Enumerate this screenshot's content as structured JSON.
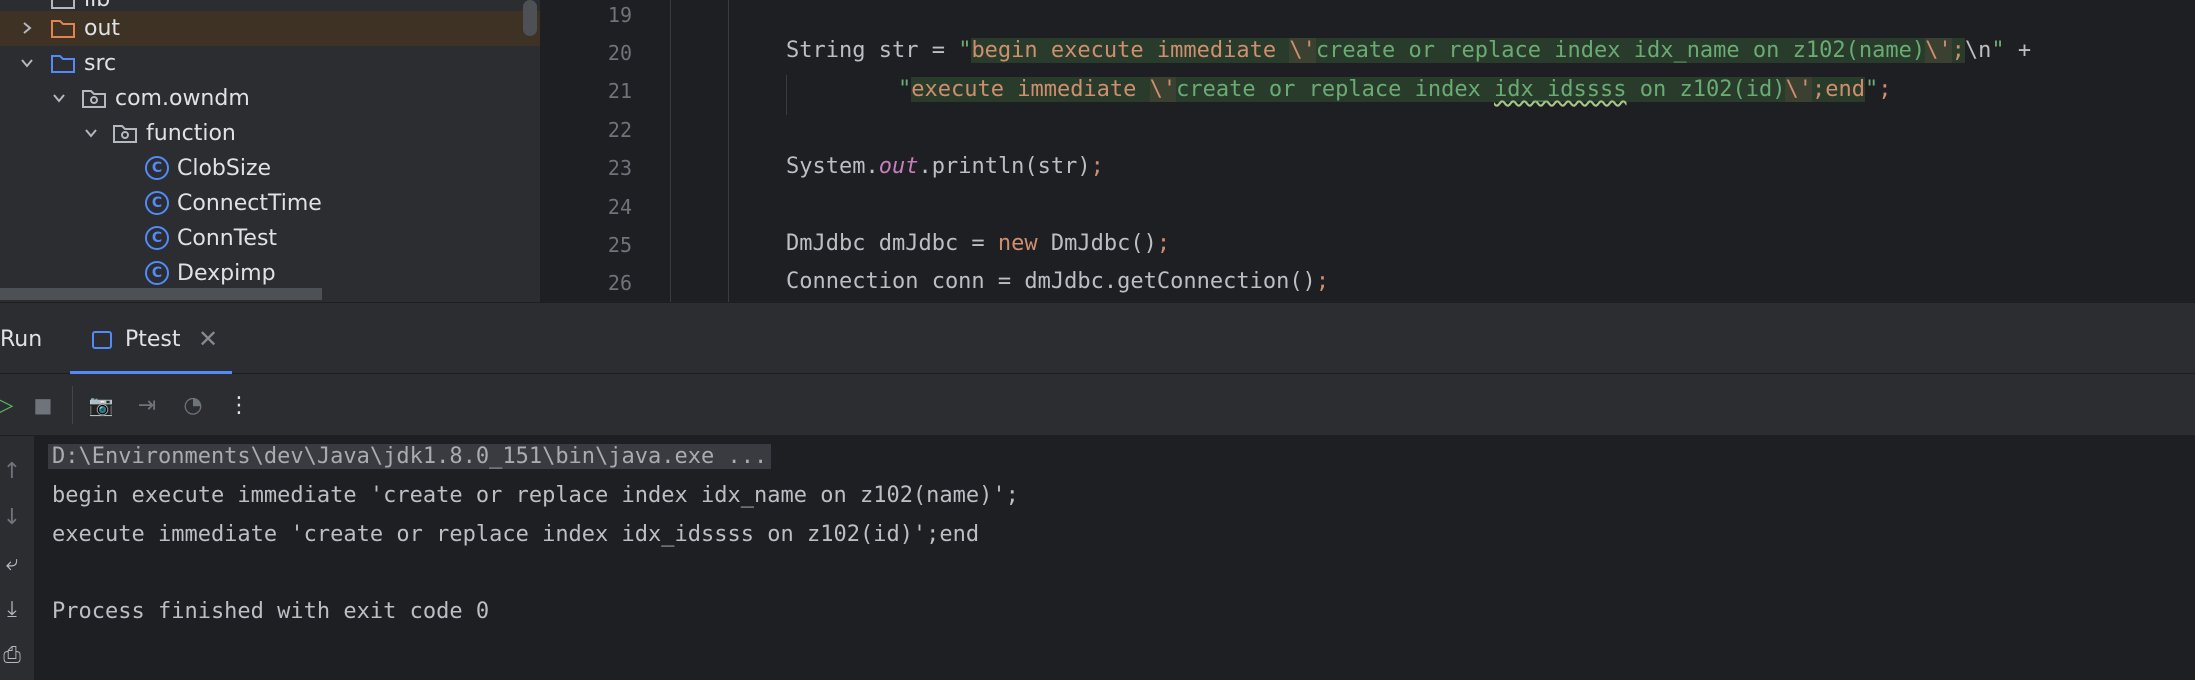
{
  "project_tree": {
    "items": [
      {
        "label": "lib",
        "type": "folder"
      },
      {
        "label": "out",
        "type": "folder-orange",
        "expanded": false
      },
      {
        "label": "src",
        "type": "folder",
        "expanded": true
      },
      {
        "label": "com.owndm",
        "type": "package",
        "expanded": true
      },
      {
        "label": "function",
        "type": "package",
        "expanded": true
      },
      {
        "label": "ClobSize",
        "type": "class"
      },
      {
        "label": "ConnectTime",
        "type": "class"
      },
      {
        "label": "ConnTest",
        "type": "class"
      },
      {
        "label": "Dexpimp",
        "type": "class"
      }
    ],
    "class_letter": "C"
  },
  "editor": {
    "line_numbers": [
      "19",
      "20",
      "21",
      "22",
      "23",
      "24",
      "25",
      "26"
    ],
    "line20": {
      "t1": "String str = ",
      "q1": "\"",
      "s1": "begin execute immediate ",
      "e1": "\\'",
      "s2": "create or replace index idx_name on z102(name)",
      "e2": "\\'",
      "s3": ";",
      "e3": "\\n",
      "q2": "\"",
      "t2": " +"
    },
    "line21": {
      "q1": "\"",
      "s1": "execute immediate ",
      "e1": "\\'",
      "s2a": "create or replace index ",
      "s2b": "idx_idssss",
      "s2c": " on z102(id)",
      "e2": "\\'",
      "s3": ";end",
      "q2": "\"",
      "semi": ";"
    },
    "line23": {
      "a": "System.",
      "b": "out",
      "c": ".println(str)",
      "semi": ";"
    },
    "line25": {
      "a": "DmJdbc dmJdbc = ",
      "kw": "new",
      "b": " DmJdbc()",
      "semi": ";"
    },
    "line26": {
      "a": "Connection conn = dmJdbc.getConnection()",
      "semi": ";"
    }
  },
  "run": {
    "title": "Run",
    "tab_label": "Ptest",
    "tab_close": "✕",
    "toolbar": {
      "rerun": "▷",
      "stop": "■",
      "screenshot": "📷",
      "login": "⇥",
      "dashboard": "◔",
      "more": "⋮"
    },
    "side": {
      "up": "↑",
      "down": "↓",
      "wrap": "⤶",
      "scroll_end": "⤓",
      "print": "⎙"
    },
    "console": {
      "command": "D:\\Environments\\dev\\Java\\jdk1.8.0_151\\bin\\java.exe ...",
      "line1": "begin execute immediate 'create or replace index idx_name on z102(name)';",
      "line2": "execute immediate 'create or replace index idx_idssss on z102(id)';end",
      "exit": "Process finished with exit code 0"
    }
  },
  "colors": {
    "accent": "#548af7",
    "string": "#6aab73",
    "keyword": "#cf8e6d",
    "field": "#c77dbb"
  }
}
